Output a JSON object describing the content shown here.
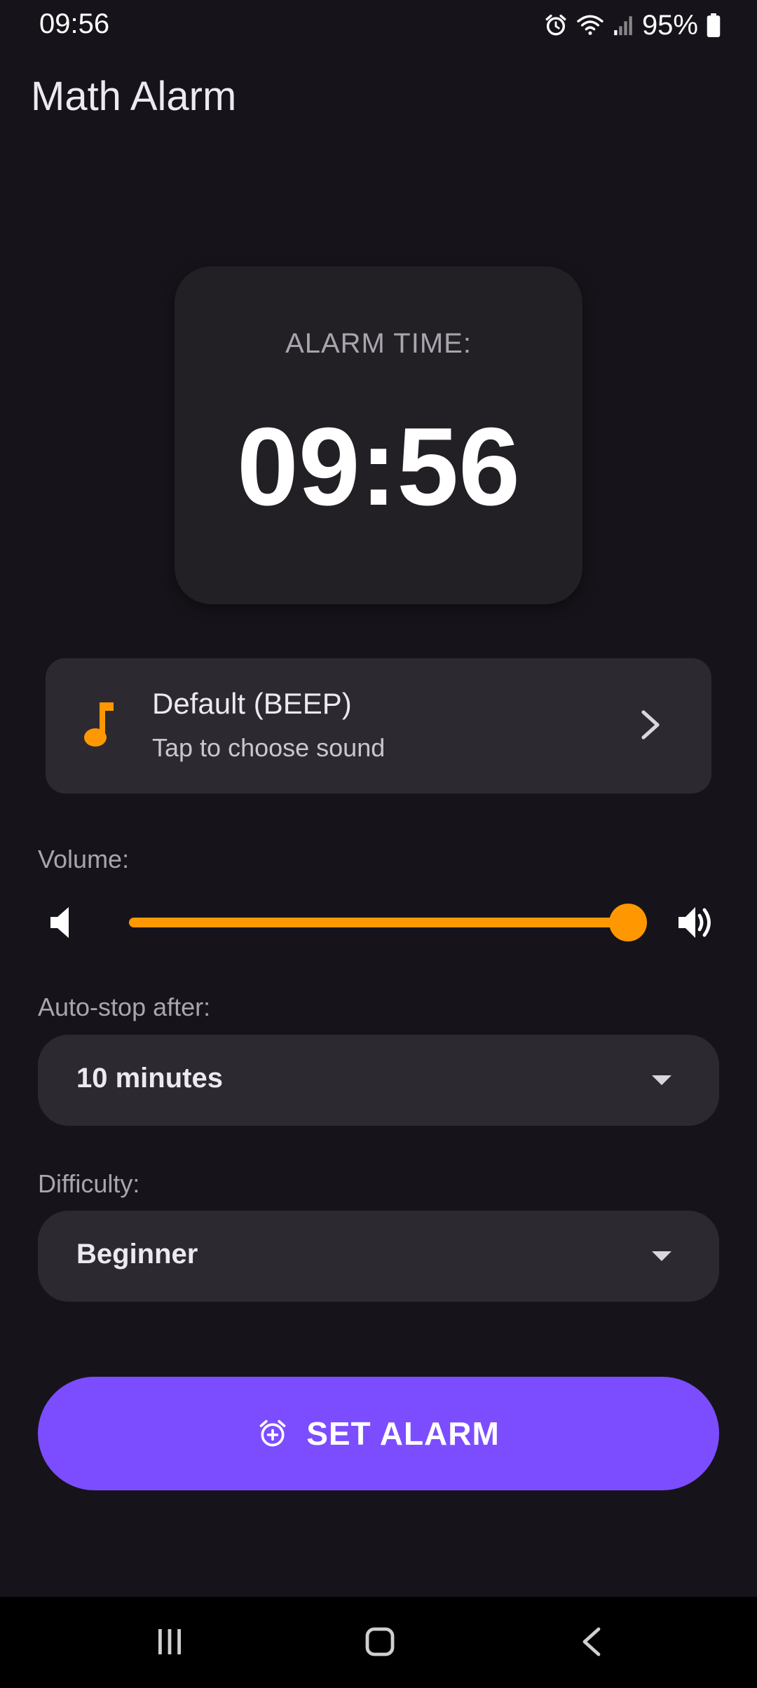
{
  "status_bar": {
    "time": "09:56",
    "battery": "95%",
    "icons": [
      "alarm-icon",
      "wifi-icon",
      "signal-icon",
      "battery-icon"
    ]
  },
  "app": {
    "title": "Math Alarm"
  },
  "alarm": {
    "label": "ALARM TIME:",
    "time": "09:56"
  },
  "sound": {
    "title": "Default (BEEP)",
    "subtitle": "Tap to choose sound",
    "icon": "music-note-icon"
  },
  "volume": {
    "label": "Volume:",
    "level_percent": 100
  },
  "auto_stop": {
    "label": "Auto-stop after:",
    "value": "10 minutes"
  },
  "difficulty": {
    "label": "Difficulty:",
    "value": "Beginner"
  },
  "set_alarm": {
    "label": "SET ALARM",
    "icon": "add-alarm-icon"
  },
  "colors": {
    "background": "#16141a",
    "accent": "#ff9800",
    "primary": "#7c4dff",
    "card": "#221f25",
    "field": "#2c2a30"
  },
  "nav": {
    "icons": [
      "recents-icon",
      "home-icon",
      "back-icon"
    ]
  }
}
